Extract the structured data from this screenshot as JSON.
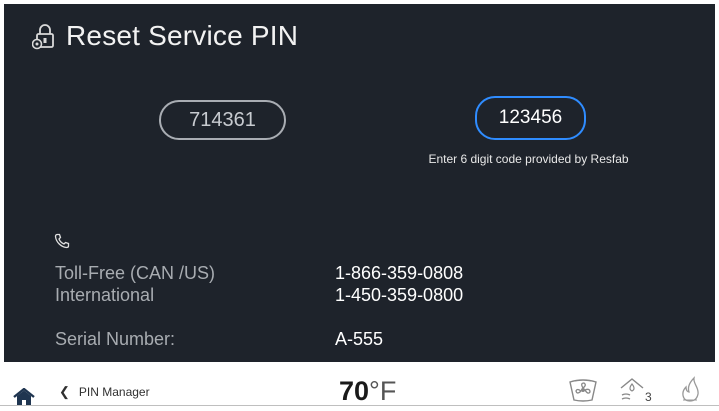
{
  "header": {
    "title": "Reset Service PIN",
    "icon": "lock-gear-icon"
  },
  "pin": {
    "current_code": "714361",
    "new_code": "123456",
    "hint": "Enter 6 digit code provided by Resfab"
  },
  "contact": {
    "icon": "phone-icon",
    "toll_free_label": "Toll-Free (CAN /US)",
    "toll_free_number": "1-866-359-0808",
    "international_label": "International",
    "international_number": "1-450-359-0800",
    "serial_label": "Serial Number:",
    "serial_value": "A-555"
  },
  "bottom_bar": {
    "home_icon": "home-icon",
    "back_label": "PIN Manager",
    "temperature_value": "70",
    "temperature_unit": "°F",
    "humidity_level": "3",
    "accent_color": "#2f8cff",
    "icons": [
      "fan-icon",
      "humidity-icon",
      "flame-icon"
    ]
  }
}
